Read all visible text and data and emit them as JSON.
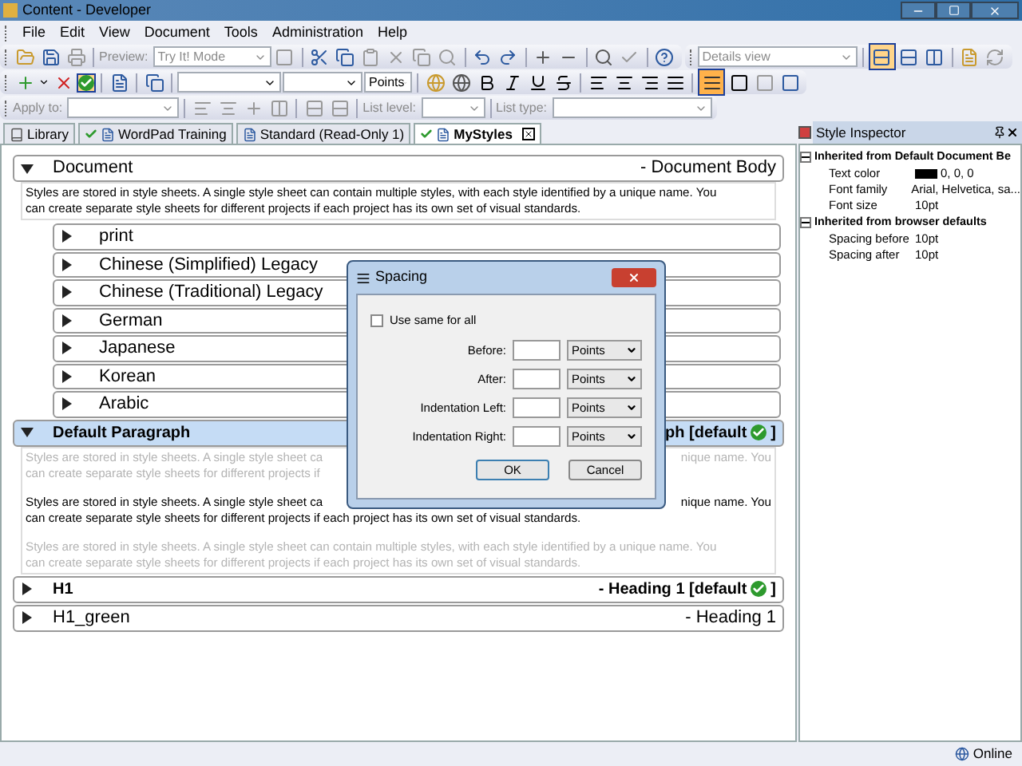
{
  "window": {
    "title": "Content - Developer"
  },
  "menu": [
    "File",
    "Edit",
    "View",
    "Document",
    "Tools",
    "Administration",
    "Help"
  ],
  "toolbar": {
    "preview_label": "Preview:",
    "mode_combo": "Try It! Mode",
    "view_combo": "Details view",
    "units_combo": "Points",
    "apply_label": "Apply to:",
    "list_level_label": "List level:",
    "list_type_label": "List type:"
  },
  "tabs": [
    {
      "label": "Library",
      "kind": "library",
      "selected": false,
      "checked": false
    },
    {
      "label": "WordPad Training",
      "kind": "document",
      "selected": false,
      "checked": true
    },
    {
      "label": "Standard (Read-Only 1)",
      "kind": "document",
      "selected": false,
      "checked": false
    },
    {
      "label": "MyStyles",
      "kind": "document",
      "selected": true,
      "checked": true
    }
  ],
  "styles": [
    {
      "name": "Document",
      "right": "- Document Body",
      "expanded": true,
      "selected": false,
      "bold": false,
      "default": false,
      "description": [
        {
          "dimmed": false,
          "lines": [
            {
              "left": "Styles are stored in style sheets. A single style sheet can contain multiple styles, with each style identified by a unique name. You"
            },
            {
              "left": "can create separate style sheets for different projects if each project has its own set of visual standards."
            }
          ]
        }
      ],
      "children": [
        {
          "name": "print",
          "expanded": false
        },
        {
          "name": "Chinese (Simplified) Legacy",
          "expanded": false
        },
        {
          "name": "Chinese (Traditional) Legacy",
          "expanded": false
        },
        {
          "name": "German",
          "expanded": false
        },
        {
          "name": "Japanese",
          "expanded": false
        },
        {
          "name": "Korean",
          "expanded": false
        },
        {
          "name": "Arabic",
          "expanded": false
        }
      ]
    },
    {
      "name": "Default Paragraph",
      "right": "ph [default",
      "close": "]",
      "expanded": true,
      "selected": true,
      "bold": true,
      "default": true,
      "description": [
        {
          "dimmed": true,
          "lines": [
            {
              "left": "Styles are stored in style sheets. A single style sheet ca",
              "right": "nique name. You"
            },
            {
              "left": "can create separate style sheets for different projects if"
            }
          ]
        },
        {
          "dimmed": false,
          "lines": [
            {
              "left": "Styles are stored in style sheets. A single style sheet ca",
              "right": "nique name. You"
            },
            {
              "left": "can create separate style sheets for different projects if each project has its own set of visual standards."
            }
          ]
        },
        {
          "dimmed": true,
          "lines": [
            {
              "left": "Styles are stored in style sheets. A single style sheet can contain multiple styles, with each style identified by a unique name. You"
            },
            {
              "left": "can create separate style sheets for different projects if each project has its own set of visual standards."
            }
          ]
        }
      ]
    },
    {
      "name": "H1",
      "right": "- Heading 1 [default",
      "close": "]",
      "expanded": false,
      "selected": false,
      "bold": true,
      "default": true
    },
    {
      "name": "H1_green",
      "right": "- Heading 1",
      "expanded": false,
      "selected": false,
      "bold": false,
      "default": false
    }
  ],
  "inspector": {
    "title": "Style Inspector",
    "groups": [
      {
        "title": "Inherited from Default Document Be",
        "expanded": true,
        "props": [
          {
            "name": "Text color",
            "value": "0, 0, 0",
            "color": "#000000"
          },
          {
            "name": "Font family",
            "value": "Arial, Helvetica, sa..."
          },
          {
            "name": "Font size",
            "value": "10pt"
          }
        ]
      },
      {
        "title": "Inherited from browser defaults",
        "expanded": true,
        "props": [
          {
            "name": "Spacing before",
            "value": "10pt"
          },
          {
            "name": "Spacing after",
            "value": "10pt"
          }
        ]
      }
    ]
  },
  "dialog": {
    "title": "Spacing",
    "same_for_all": {
      "label": "Use same for all",
      "checked": false
    },
    "rows": [
      {
        "label": "Before:",
        "unit": "Points"
      },
      {
        "label": "After:",
        "unit": "Points"
      },
      {
        "label": "Indentation Left:",
        "unit": "Points"
      },
      {
        "label": "Indentation Right:",
        "unit": "Points"
      }
    ],
    "buttons": [
      "OK",
      "Cancel"
    ]
  },
  "status": {
    "text": "Online"
  }
}
